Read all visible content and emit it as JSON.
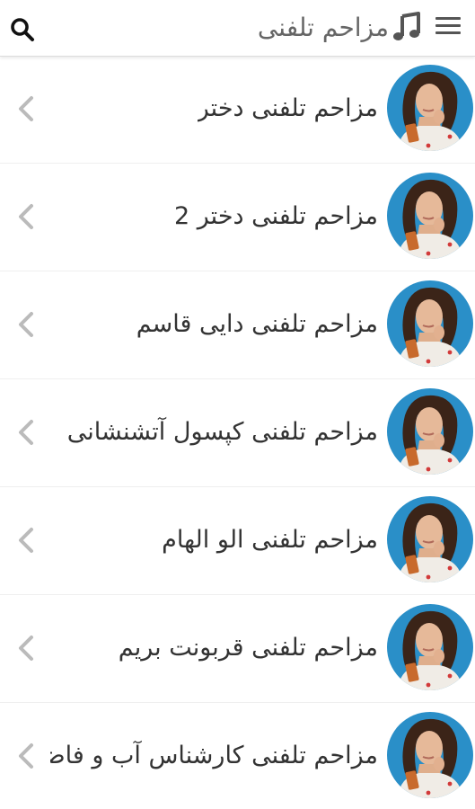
{
  "header": {
    "title": "مزاحم تلفنی",
    "menu_icon": "hamburger-menu-icon",
    "music_icon": "music-note-icon",
    "search_icon": "search-icon"
  },
  "colors": {
    "header_bg": "#ffffff",
    "title_text": "#666666",
    "item_text": "#333333",
    "chevron": "#bbbbbb",
    "avatar_bg": "#2a8fc8"
  },
  "list": {
    "items": [
      {
        "label": "مزاحم تلفنی دختر"
      },
      {
        "label": "مزاحم تلفنی دختر 2"
      },
      {
        "label": "مزاحم تلفنی دایی قاسم"
      },
      {
        "label": "مزاحم تلفنی کپسول آتشنشانی"
      },
      {
        "label": "مزاحم تلفنی الو الهام"
      },
      {
        "label": "مزاحم تلفنی قربونت بریم"
      },
      {
        "label": "مزاحم تلفنی کارشناس آب و فاضلاب"
      }
    ]
  }
}
